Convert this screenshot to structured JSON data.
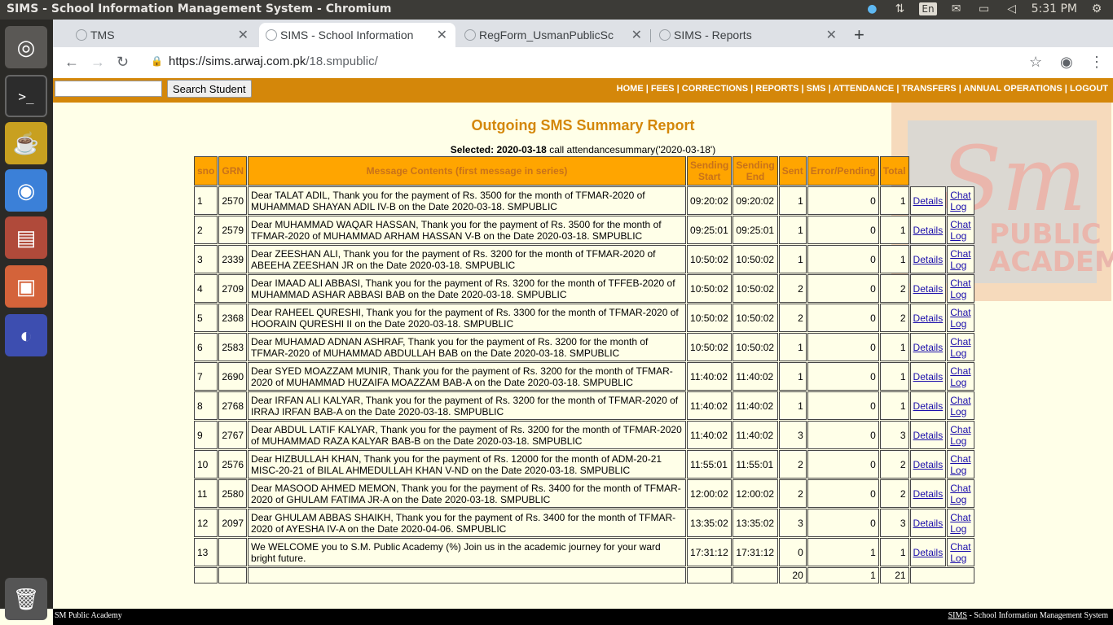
{
  "os": {
    "window_title": "SIMS - School Information Management System - Chromium",
    "keyboard_lang": "En",
    "clock": "5:31 PM"
  },
  "browser": {
    "tabs": [
      {
        "title": "TMS"
      },
      {
        "title": "SIMS - School Information"
      },
      {
        "title": "RegForm_UsmanPublicSc"
      },
      {
        "title": "SIMS - Reports"
      }
    ],
    "url_host": "https://sims.arwaj.com.pk",
    "url_path": "/18.smpublic/"
  },
  "header": {
    "search_placeholder": "",
    "search_button": "Search Student",
    "nav": [
      "HOME",
      "FEES",
      "CORRECTIONS",
      "REPORTS",
      "SMS",
      "ATTENDANCE",
      "TRANSFERS",
      "ANNUAL OPERATIONS",
      "LOGOUT"
    ]
  },
  "logo": {
    "initials": "Sm",
    "line1": "PUBLIC",
    "line2": "ACADEMY"
  },
  "report": {
    "title": "Outgoing SMS Summary Report",
    "selected_label": "Selected:",
    "selected_date": "2020-03-18",
    "call_text": "call attendancesummary('2020-03-18')",
    "columns": [
      "sno",
      "GRN",
      "Message Contents (first message in series)",
      "Sending Start",
      "Sending End",
      "Sent",
      "Error/Pending",
      "Total"
    ],
    "details_label": "Details",
    "chat_label_1": "Chat",
    "chat_label_2": "Log",
    "rows": [
      {
        "sno": "1",
        "grn": "2570",
        "msg": "Dear TALAT ADIL, Thank you for the payment of Rs. 3500 for the month of TFMAR-2020 of MUHAMMAD SHAYAN ADIL IV-B on the Date 2020-03-18. SMPUBLIC",
        "start": "09:20:02",
        "end": "09:20:02",
        "sent": "1",
        "err": "0",
        "total": "1"
      },
      {
        "sno": "2",
        "grn": "2579",
        "msg": "Dear MUHAMMAD WAQAR HASSAN, Thank you for the payment of Rs. 3500 for the month of TFMAR-2020 of MUHAMMAD ARHAM HASSAN V-B on the Date 2020-03-18. SMPUBLIC",
        "start": "09:25:01",
        "end": "09:25:01",
        "sent": "1",
        "err": "0",
        "total": "1"
      },
      {
        "sno": "3",
        "grn": "2339",
        "msg": "Dear ZEESHAN ALI, Thank you for the payment of Rs. 3200 for the month of TFMAR-2020 of ABEEHA ZEESHAN JR on the Date 2020-03-18. SMPUBLIC",
        "start": "10:50:02",
        "end": "10:50:02",
        "sent": "1",
        "err": "0",
        "total": "1"
      },
      {
        "sno": "4",
        "grn": "2709",
        "msg": "Dear IMAAD ALI ABBASI, Thank you for the payment of Rs. 3200 for the month of TFFEB-2020 of MUHAMMAD ASHAR ABBASI BAB on the Date 2020-03-18. SMPUBLIC",
        "start": "10:50:02",
        "end": "10:50:02",
        "sent": "2",
        "err": "0",
        "total": "2"
      },
      {
        "sno": "5",
        "grn": "2368",
        "msg": "Dear RAHEEL QURESHI, Thank you for the payment of Rs. 3300 for the month of TFMAR-2020 of HOORAIN QURESHI II on the Date 2020-03-18. SMPUBLIC",
        "start": "10:50:02",
        "end": "10:50:02",
        "sent": "2",
        "err": "0",
        "total": "2"
      },
      {
        "sno": "6",
        "grn": "2583",
        "msg": "Dear MUHAMAD ADNAN ASHRAF, Thank you for the payment of Rs. 3200 for the month of TFMAR-2020 of MUHAMMAD ABDULLAH BAB on the Date 2020-03-18. SMPUBLIC",
        "start": "10:50:02",
        "end": "10:50:02",
        "sent": "1",
        "err": "0",
        "total": "1"
      },
      {
        "sno": "7",
        "grn": "2690",
        "msg": "Dear SYED MOAZZAM MUNIR, Thank you for the payment of Rs. 3200 for the month of TFMAR-2020 of MUHAMMAD HUZAIFA MOAZZAM BAB-A on the Date 2020-03-18. SMPUBLIC",
        "start": "11:40:02",
        "end": "11:40:02",
        "sent": "1",
        "err": "0",
        "total": "1"
      },
      {
        "sno": "8",
        "grn": "2768",
        "msg": "Dear IRFAN ALI KALYAR, Thank you for the payment of Rs. 3200 for the month of TFMAR-2020 of IRRAJ IRFAN BAB-A on the Date 2020-03-18. SMPUBLIC",
        "start": "11:40:02",
        "end": "11:40:02",
        "sent": "1",
        "err": "0",
        "total": "1"
      },
      {
        "sno": "9",
        "grn": "2767",
        "msg": "Dear ABDUL LATIF KALYAR, Thank you for the payment of Rs. 3200 for the month of TFMAR-2020 of MUHAMMAD RAZA KALYAR BAB-B on the Date 2020-03-18. SMPUBLIC",
        "start": "11:40:02",
        "end": "11:40:02",
        "sent": "3",
        "err": "0",
        "total": "3"
      },
      {
        "sno": "10",
        "grn": "2576",
        "msg": "Dear HIZBULLAH KHAN, Thank you for the payment of Rs. 12000 for the month of ADM-20-21 MISC-20-21 of BILAL AHMEDULLAH KHAN V-ND on the Date 2020-03-18. SMPUBLIC",
        "start": "11:55:01",
        "end": "11:55:01",
        "sent": "2",
        "err": "0",
        "total": "2"
      },
      {
        "sno": "11",
        "grn": "2580",
        "msg": "Dear MASOOD AHMED MEMON, Thank you for the payment of Rs. 3400 for the month of TFMAR-2020 of GHULAM FATIMA JR-A on the Date 2020-03-18. SMPUBLIC",
        "start": "12:00:02",
        "end": "12:00:02",
        "sent": "2",
        "err": "0",
        "total": "2"
      },
      {
        "sno": "12",
        "grn": "2097",
        "msg": "Dear GHULAM ABBAS SHAIKH, Thank you for the payment of Rs. 3400 for the month of TFMAR-2020 of AYESHA IV-A on the Date 2020-04-06. SMPUBLIC",
        "start": "13:35:02",
        "end": "13:35:02",
        "sent": "3",
        "err": "0",
        "total": "3"
      },
      {
        "sno": "13",
        "grn": "",
        "msg": "We WELCOME you to S.M. Public Academy (%) Join us in the academic journey for your ward bright future.",
        "start": "17:31:12",
        "end": "17:31:12",
        "sent": "0",
        "err": "1",
        "total": "1"
      }
    ],
    "totals": {
      "sent": "20",
      "err": "1",
      "total": "21"
    }
  },
  "footer": {
    "left": "SM Public Academy",
    "right_link": "SIMS",
    "right_text": " - School Information Management System"
  }
}
